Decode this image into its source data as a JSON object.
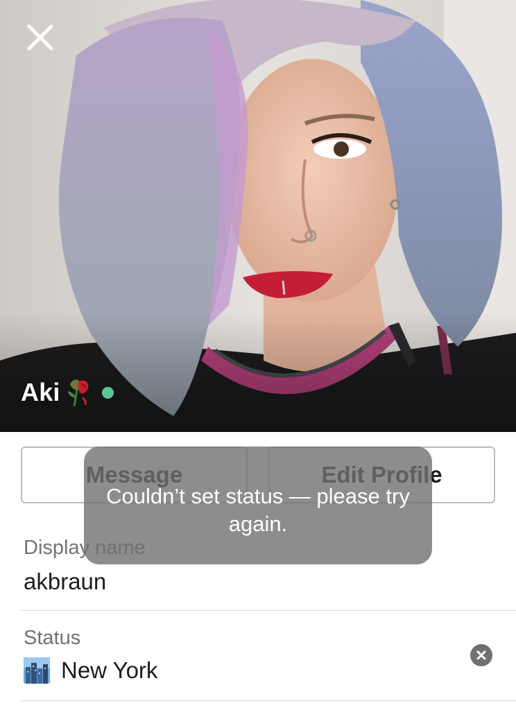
{
  "profile": {
    "name": "Aki",
    "name_emoji": "rose-emoji",
    "presence": "active",
    "presence_color": "#5cc596"
  },
  "header": {
    "close_icon": "close-icon"
  },
  "actions": {
    "message_label": "Message",
    "edit_profile_label": "Edit Profile"
  },
  "fields": {
    "display_name_label": "Display name",
    "display_name_value": "akbraun",
    "status_label": "Status",
    "status_emoji": "cityscape-emoji",
    "status_value": "New York",
    "clear_icon": "clear-x-icon"
  },
  "toast": {
    "message": "Couldn’t set status — please try again."
  },
  "colors": {
    "text_primary": "#1d1c1d",
    "text_secondary": "#717274",
    "button_border": "#bdbdbd",
    "toast_background": "#707070"
  }
}
